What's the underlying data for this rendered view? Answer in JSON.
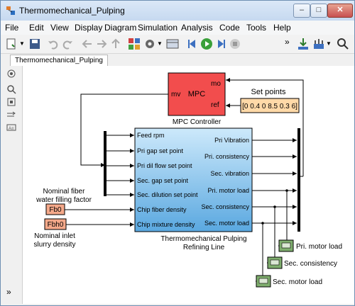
{
  "window": {
    "title": "Thermomechanical_Pulping",
    "minimize_glyph": "–",
    "maximize_glyph": "□",
    "close_glyph": "✕",
    "icon": "simulink-model-icon"
  },
  "menu": [
    "File",
    "Edit",
    "View",
    "Display",
    "Diagram",
    "Simulation",
    "Analysis",
    "Code",
    "Tools",
    "Help"
  ],
  "toolbar": {
    "overflow_glyph": "»"
  },
  "tab": {
    "label": "Thermomechanical_Pulping"
  },
  "leftbar": {
    "collapse_glyph": "»"
  },
  "diagram": {
    "mpc": {
      "title": "MPC",
      "port_mv": "mv",
      "port_mo": "mo",
      "port_ref": "ref",
      "label": "MPC Controller",
      "color": "#f24d4d"
    },
    "setpoints": {
      "title": "Set points",
      "value": "[0 0.4 0 8.5 0.3 6]",
      "color": "#ffd9a8"
    },
    "plant": {
      "inputs": [
        "Feed rpm",
        "Pri gap set point",
        "Pri dil flow set point",
        "Sec. gap set point",
        "Sec. dilution set point",
        "Chip fiber density",
        "Chip mixture density"
      ],
      "outputs": [
        "Pri Vibration",
        "Pri. consistency",
        "Sec. vibration",
        "Pri. motor load",
        "Sec. consistency",
        "Sec. motor load"
      ],
      "label_line1": "Thermomechanical Pulping",
      "label_line2": "Refining Line"
    },
    "fb0": {
      "name": "Fb0",
      "label_line1": "Nominal fiber",
      "label_line2": "water filling factor",
      "color": "#f5a98a"
    },
    "fbh0": {
      "name": "Fbh0",
      "label_line1": "Nominal inlet",
      "label_line2": "slurry density",
      "color": "#f5a98a"
    },
    "scopes": [
      "Pri. motor load",
      "Sec. consistency",
      "Sec. motor load"
    ],
    "scope_color": "#7fae6e"
  }
}
